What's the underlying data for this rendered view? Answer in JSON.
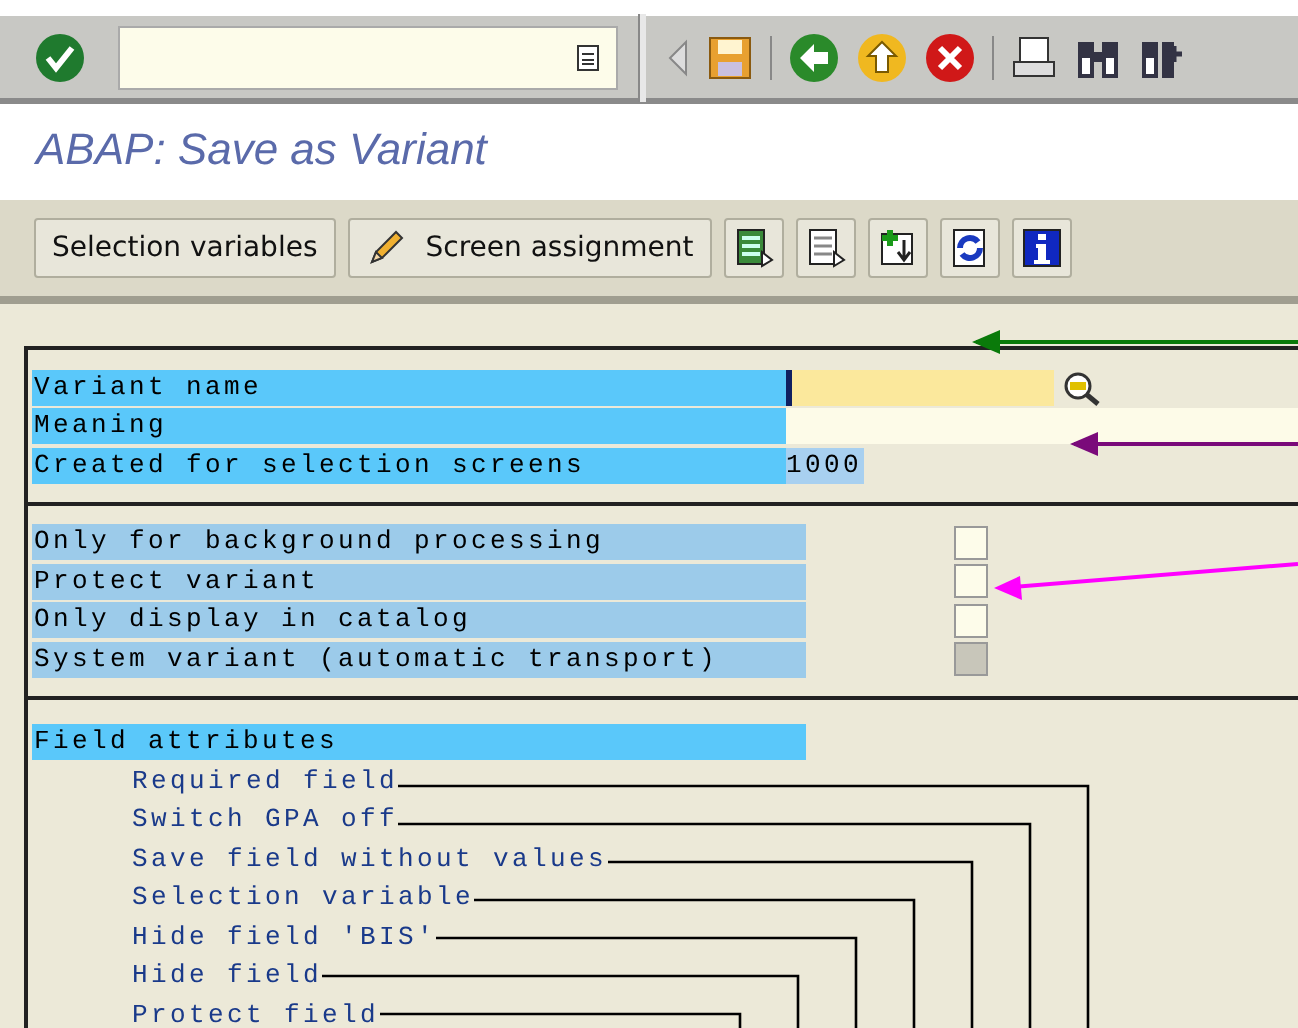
{
  "window": {
    "title": "ABAP: Save as Variant"
  },
  "application_toolbar": {
    "buttons": [
      {
        "label": "Selection variables",
        "kind": "text"
      },
      {
        "label": "Screen assignment",
        "kind": "pencil"
      }
    ]
  },
  "variant_fields": [
    {
      "label": "Variant name",
      "kind": "required_input"
    },
    {
      "label": "Meaning",
      "kind": "input"
    },
    {
      "label": "Created for selection screens",
      "kind": "output",
      "value": "1000"
    }
  ],
  "options": [
    {
      "label": "Only for background processing",
      "checked": false,
      "disabled": false
    },
    {
      "label": "Protect variant",
      "checked": false,
      "disabled": false
    },
    {
      "label": "Only display in catalog",
      "checked": false,
      "disabled": false
    },
    {
      "label": "System variant (automatic transport)",
      "checked": false,
      "disabled": true
    }
  ],
  "field_attributes": {
    "title": "Field attributes",
    "items": [
      "Required field",
      "Switch GPA off",
      "Save field without values",
      "Selection variable",
      "Hide field 'BIS'",
      "Hide field",
      "Protect field"
    ]
  }
}
